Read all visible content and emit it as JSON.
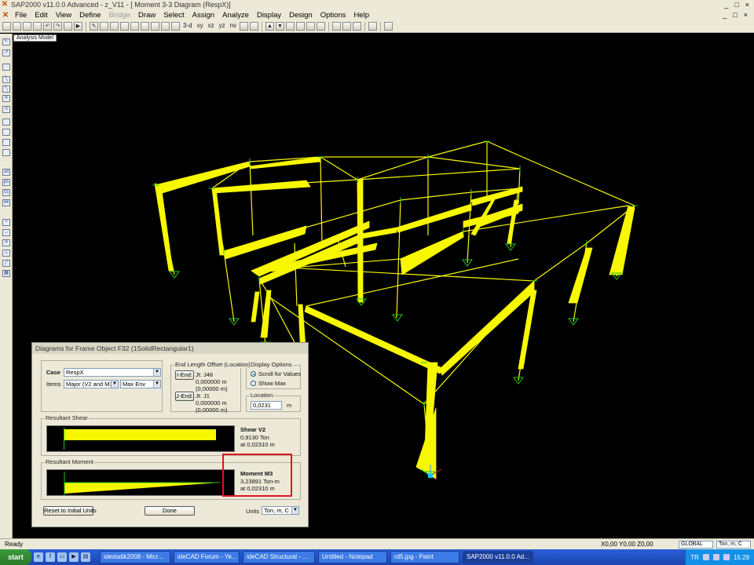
{
  "window": {
    "title": "SAP2000 v11.0.0 Advanced  - z_V11 - [  Moment 3-3 Diagram  (RespX)]",
    "controls": [
      "_",
      "□",
      "×"
    ]
  },
  "menubar": {
    "items": [
      {
        "label": "File",
        "enabled": true
      },
      {
        "label": "Edit",
        "enabled": true
      },
      {
        "label": "View",
        "enabled": true
      },
      {
        "label": "Define",
        "enabled": true
      },
      {
        "label": "Bridge",
        "enabled": false
      },
      {
        "label": "Draw",
        "enabled": true
      },
      {
        "label": "Select",
        "enabled": true
      },
      {
        "label": "Assign",
        "enabled": true
      },
      {
        "label": "Analyze",
        "enabled": true
      },
      {
        "label": "Display",
        "enabled": true
      },
      {
        "label": "Design",
        "enabled": true
      },
      {
        "label": "Options",
        "enabled": true
      },
      {
        "label": "Help",
        "enabled": true
      }
    ],
    "mdi_controls": [
      "_",
      "□",
      "×"
    ]
  },
  "toolbar": {
    "view_labels": [
      "3-d",
      "xy",
      "xz",
      "yz",
      "nv"
    ]
  },
  "canvas": {
    "tab_label": "Analysis Model"
  },
  "dialog": {
    "title": "Diagrams for Frame Object F32  (1SolidRectangular1)",
    "case_label": "Case",
    "case_value": "RespX",
    "items_label": "Items",
    "items_value": "Major (V2 and M3)",
    "env_value": "Max Env",
    "end_offset": {
      "title": "End Length Offset (Location)",
      "i_end_button": "I-End:",
      "i_joint": "Jt:  J48",
      "i_val1": "0,000000 m",
      "i_val2": "(0,00000 m)",
      "j_end_button": "J-End:",
      "j_joint": "Jt:  J1",
      "j_val1": "0,000000 m",
      "j_val2": "(0,00000 m)"
    },
    "display_options": {
      "title": "Display Options",
      "scroll_label": "Scroll for Values",
      "showmax_label": "Show Max"
    },
    "location": {
      "title": "Location",
      "value": "0,0231",
      "unit": "m"
    },
    "shear": {
      "group_title": "Resultant Shear",
      "title": "Shear V2",
      "value": "0,9130 Ton",
      "at": "at 0,02310 m"
    },
    "moment": {
      "group_title": "Resultant Moment",
      "title": "Moment M3",
      "value": "3,23891 Ton-m",
      "at": "at 0,02310 m"
    },
    "reset_button": "Reset to Initial Units",
    "done_button": "Done",
    "units_label": "Units",
    "units_value": "Ton, m, C"
  },
  "statusbar": {
    "status": "Ready",
    "coords": "X0,00  Y0,00  Z0,00",
    "coord_system": "GLOBAL",
    "units": "Ton, m, C"
  },
  "taskbar": {
    "start_label": "start",
    "tasks": [
      {
        "label": "idestatik2008 - Micr...",
        "active": false
      },
      {
        "label": "ideCAD Forum - Ye...",
        "active": false
      },
      {
        "label": "ideCAD Structural - ...",
        "active": false
      },
      {
        "label": "Untitled - Notepad",
        "active": false
      },
      {
        "label": "rd5.jpg - Paint",
        "active": false
      },
      {
        "label": "SAP2000 v11.0.0 Ad...",
        "active": true
      }
    ],
    "lang": "TR",
    "clock": "15:29"
  },
  "colors": {
    "diagram_fill": "#f7f700",
    "joint_marker": "#1ec81e",
    "highlight": "#e0141e",
    "canvas_bg": "#000000"
  }
}
